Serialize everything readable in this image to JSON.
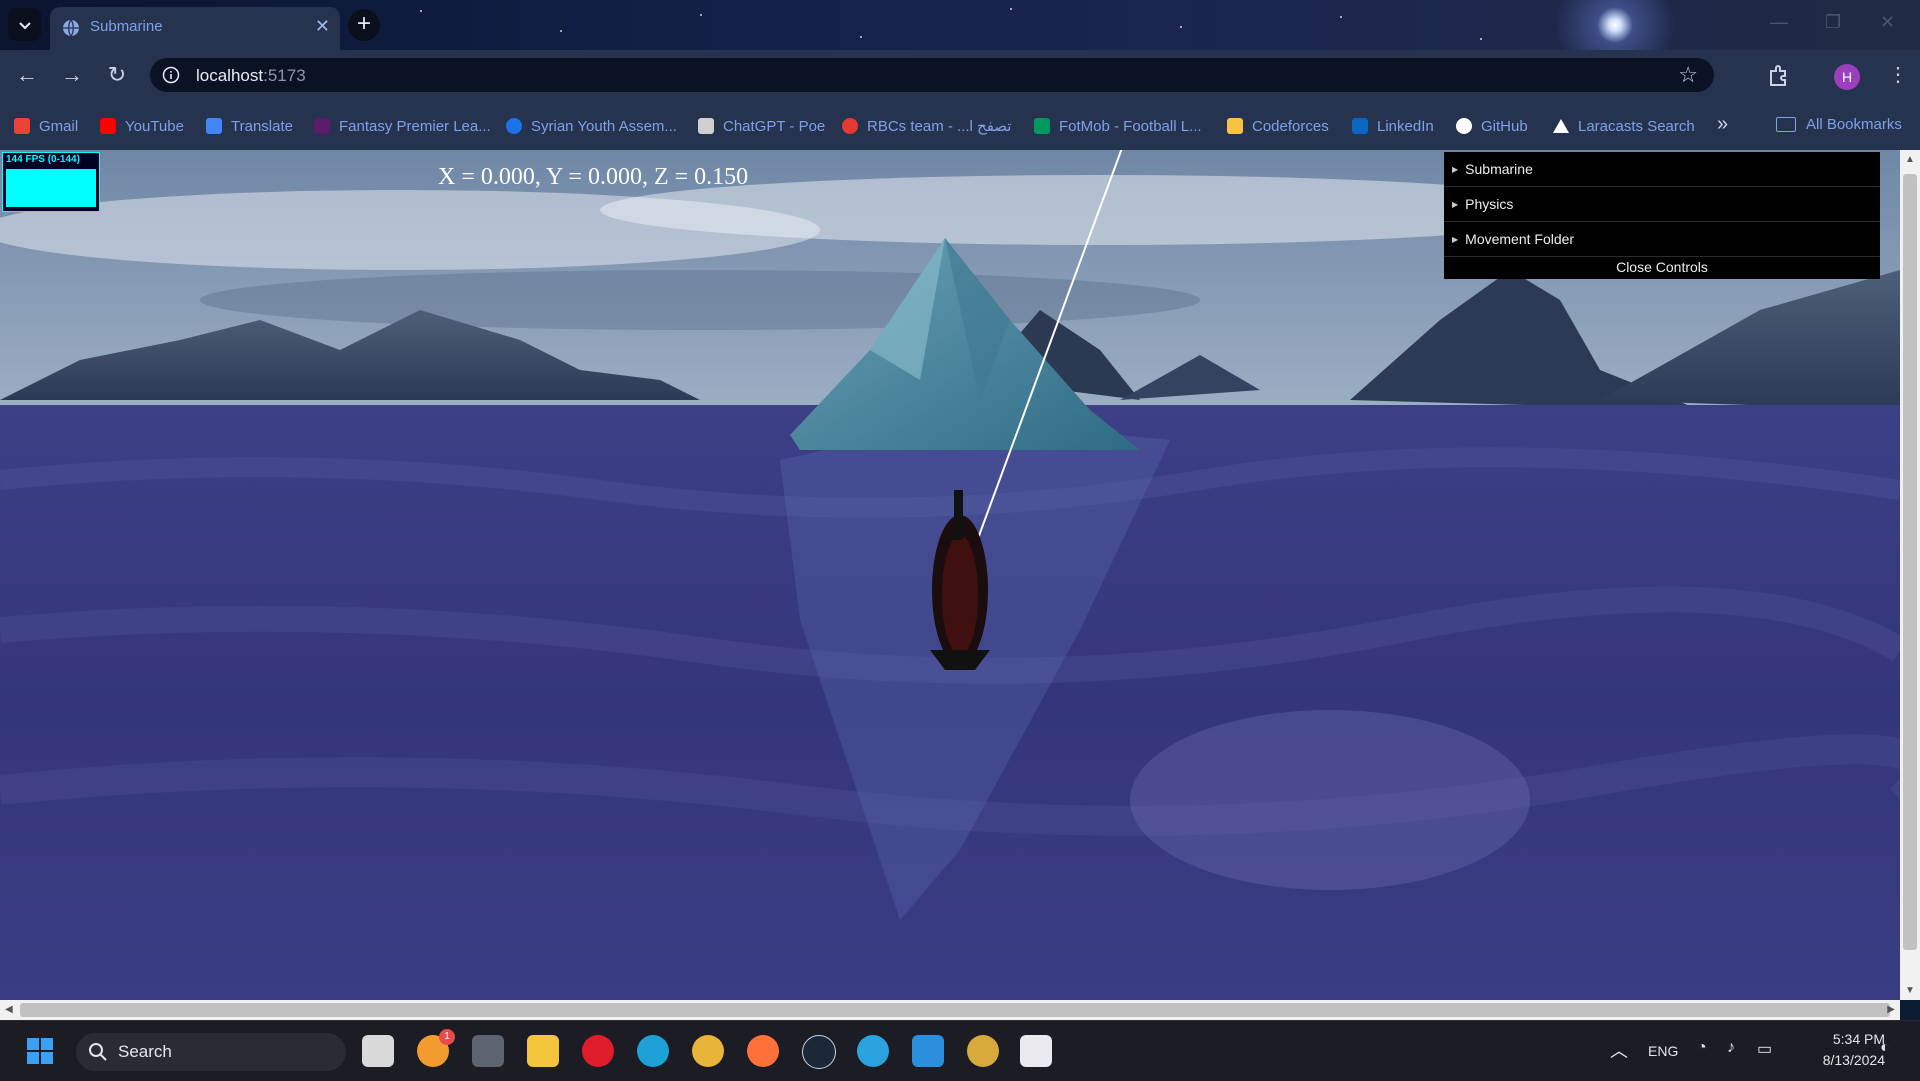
{
  "browser": {
    "tab": {
      "title": "Submarine",
      "favicon": "globe-icon"
    },
    "url": {
      "host": "localhost",
      "port": ":5173"
    },
    "profile_initial": "H",
    "bookmarks": [
      {
        "label": "Gmail",
        "icon": "gmail-icon",
        "color": "#ea4335"
      },
      {
        "label": "YouTube",
        "icon": "youtube-icon",
        "color": "#ff0000"
      },
      {
        "label": "Translate",
        "icon": "translate-icon",
        "color": "#4285f4"
      },
      {
        "label": "Fantasy Premier Lea...",
        "icon": "fpl-icon",
        "color": "#37003c"
      },
      {
        "label": "Syrian Youth Assem...",
        "icon": "syrian-youth-icon",
        "color": "#1a73e8"
      },
      {
        "label": "ChatGPT - Poe",
        "icon": "poe-icon",
        "color": "#cfcfcf"
      },
      {
        "label": "RBCs team - ...l تصفح",
        "icon": "rbcs-icon",
        "color": "#e53935"
      },
      {
        "label": "FotMob - Football L...",
        "icon": "fotmob-icon",
        "color": "#00985f"
      },
      {
        "label": "Codeforces",
        "icon": "codeforces-icon",
        "color": "#f6c343"
      },
      {
        "label": "LinkedIn",
        "icon": "linkedin-icon",
        "color": "#0a66c2"
      },
      {
        "label": "GitHub",
        "icon": "github-icon",
        "color": "#ffffff"
      },
      {
        "label": "Laracasts Search",
        "icon": "laracasts-icon",
        "color": "#ffffff"
      }
    ],
    "all_bookmarks": "All Bookmarks"
  },
  "app": {
    "fps_label": "144 FPS (0-144)",
    "coords": "X = 0.000, Y = 0.000, Z = 0.150",
    "gui": {
      "folders": [
        "Submarine",
        "Physics",
        "Movement Folder"
      ],
      "close": "Close Controls"
    }
  },
  "taskbar": {
    "search_label": "Search",
    "notification_badge": "1",
    "language": "ENG",
    "time": "5:34 PM",
    "date": "8/13/2024",
    "apps": [
      "task-view-icon",
      "browser-app-icon",
      "unity-icon",
      "file-explorer-icon",
      "opera-icon",
      "edge-icon",
      "chrome-icon",
      "firefox-icon",
      "steam-icon",
      "telegram-icon",
      "vscode-icon",
      "chrome-profile-icon",
      "snipping-tool-icon"
    ]
  }
}
